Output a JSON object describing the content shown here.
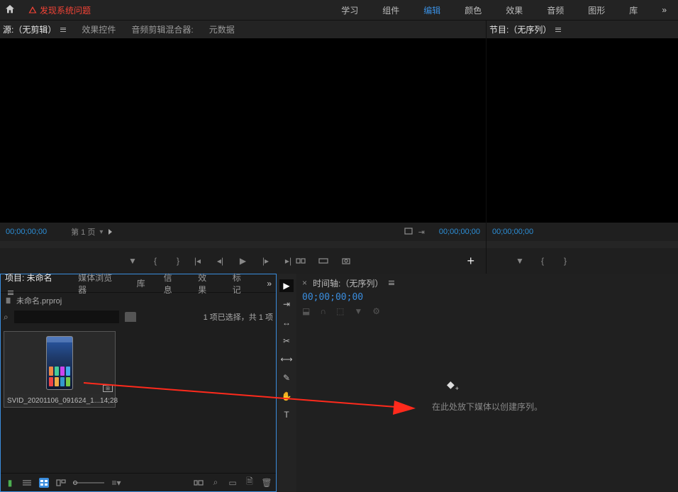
{
  "topbar": {
    "warning": "发现系统问题",
    "workspaces": [
      "学习",
      "组件",
      "编辑",
      "颜色",
      "效果",
      "音频",
      "图形",
      "库"
    ],
    "active_workspace": "编辑"
  },
  "source_panel": {
    "tabs": [
      "源:（无剪辑）",
      "效果控件",
      "音频剪辑混合器:",
      "元数据"
    ],
    "active_tab": "源:（无剪辑）",
    "timecode_in": "00;00;00;00",
    "page_label": "第 1 页",
    "timecode_out": "00;00;00;00"
  },
  "program_panel": {
    "title": "节目:（无序列）",
    "timecode": "00;00;00;00"
  },
  "project_panel": {
    "tabs": [
      "项目: 未命名",
      "媒体浏览器",
      "库",
      "信息",
      "效果",
      "标记"
    ],
    "active_tab": "项目: 未命名",
    "project_file": "未命名.prproj",
    "search_placeholder": "",
    "selection_text": "1 项已选择，共 1 项",
    "clip": {
      "name": "SVID_20201106_091624_1...",
      "duration": "14;28"
    }
  },
  "timeline_panel": {
    "title": "时间轴:（无序列）",
    "timecode": "00;00;00;00",
    "drop_hint": "在此处放下媒体以创建序列。"
  },
  "chart_data": null
}
